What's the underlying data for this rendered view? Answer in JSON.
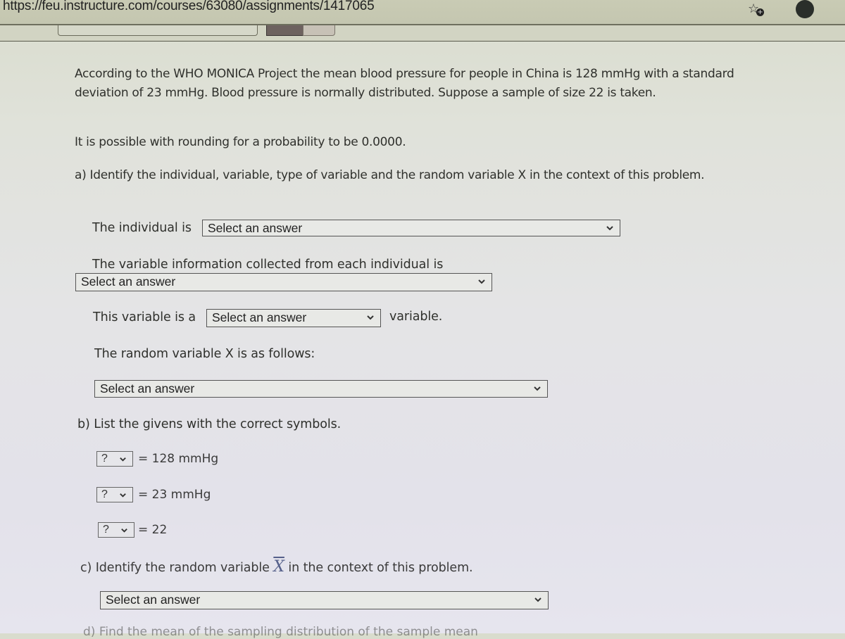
{
  "browser": {
    "url": "https://feu.instructure.com/courses/63080/assignments/1417065",
    "icons": [
      "bookmark-star-add-icon",
      "profile-icon"
    ]
  },
  "problem": {
    "intro": "According to the WHO MONICA Project the mean blood pressure for people in China is 128 mmHg with a standard deviation of 23 mmHg. Blood pressure is normally distributed. Suppose a sample of size 22 is taken.",
    "rounding_note": "It is possible with rounding for a probability to be 0.0000."
  },
  "part_a": {
    "heading": "a) Identify the individual, variable, type of variable and the random variable X in the context of this problem.",
    "individual_label": "The individual is",
    "individual_select": "Select an answer",
    "variable_label": "The variable information collected from each individual is",
    "variable_select": "Select an answer",
    "type_label": "This variable is a",
    "type_select": "Select an answer",
    "type_suffix": "variable.",
    "random_var_label": "The random variable X is as follows:",
    "random_var_select": "Select an answer"
  },
  "part_b": {
    "heading": "b) List the givens with the correct symbols.",
    "givens": [
      {
        "symbol_select": "?",
        "value": "= 128 mmHg"
      },
      {
        "symbol_select": "?",
        "value": "= 23 mmHg"
      },
      {
        "symbol_select": "?",
        "value": "= 22"
      }
    ]
  },
  "part_c": {
    "heading_before": "c) Identify the random variable",
    "symbol": "X",
    "heading_after": "in the context of this problem.",
    "select": "Select an answer"
  },
  "part_d": {
    "heading_partial": "d) Find the mean of the sampling distribution of the sample mean"
  }
}
